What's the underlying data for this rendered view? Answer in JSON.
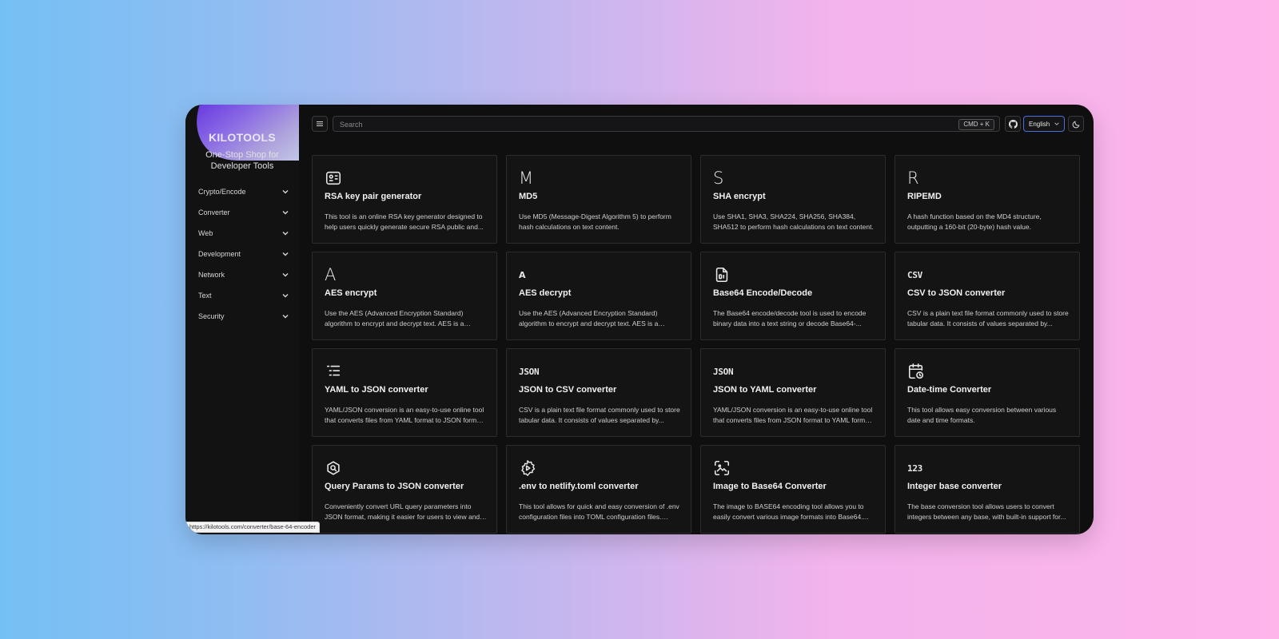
{
  "brand": {
    "title": "KILOTOOLS",
    "subtitle": "One-Stop Shop for Developer Tools"
  },
  "sidebar": {
    "items": [
      {
        "label": "Crypto/Encode"
      },
      {
        "label": "Converter"
      },
      {
        "label": "Web"
      },
      {
        "label": "Development"
      },
      {
        "label": "Network"
      },
      {
        "label": "Text"
      },
      {
        "label": "Security"
      }
    ]
  },
  "topbar": {
    "search_placeholder": "Search",
    "shortcut": "CMD + K",
    "language": "English"
  },
  "cards": [
    {
      "icon": "id-card-icon",
      "title": "RSA key pair generator",
      "desc": "This tool is an online RSA key generator designed to help users quickly generate secure RSA public and..."
    },
    {
      "icon_text": "M",
      "title": "MD5",
      "desc": "Use MD5 (Message-Digest Algorithm 5) to perform hash calculations on text content."
    },
    {
      "icon_text": "S",
      "title": "SHA encrypt",
      "desc": "Use SHA1, SHA3, SHA224, SHA256, SHA384, SHA512 to perform hash calculations on text content."
    },
    {
      "icon_text": "R",
      "title": "RIPEMD",
      "desc": "A hash function based on the MD4 structure, outputting a 160-bit (20-byte) hash value."
    },
    {
      "icon_text": "A",
      "title": "AES encrypt",
      "desc": "Use the AES (Advanced Encryption Standard) algorithm to encrypt and decrypt text. AES is a symmetric..."
    },
    {
      "icon_text": "A",
      "title": "AES decrypt",
      "desc": "Use the AES (Advanced Encryption Standard) algorithm to encrypt and decrypt text. AES is a symmetric..."
    },
    {
      "icon": "binary-file-icon",
      "title": "Base64 Encode/Decode",
      "desc": "The Base64 encode/decode tool is used to encode binary data into a text string or decode Base64-..."
    },
    {
      "icon_text": "CSV",
      "title": "CSV to JSON converter",
      "desc": "CSV is a plain text file format commonly used to store tabular data. It consists of values separated by..."
    },
    {
      "icon": "list-tree-icon",
      "title": "YAML to JSON converter",
      "desc": "YAML/JSON conversion is an easy-to-use online tool that converts files from YAML format to JSON format. ..."
    },
    {
      "icon_text": "JSON",
      "title": "JSON to CSV converter",
      "desc": "CSV is a plain text file format commonly used to store tabular data. It consists of values separated by..."
    },
    {
      "icon_text": "JSON",
      "title": "JSON to YAML converter",
      "desc": "YAML/JSON conversion is an easy-to-use online tool that converts files from JSON format to YAML format. ..."
    },
    {
      "icon": "calendar-clock-icon",
      "title": "Date-time Converter",
      "desc": "This tool allows easy conversion between various date and time formats."
    },
    {
      "icon": "search-badge-icon",
      "title": "Query Params to JSON converter",
      "desc": "Conveniently convert URL query parameters into JSON format, making it easier for users to view and use."
    },
    {
      "icon": "gear-play-icon",
      "title": ".env to netlify.toml converter",
      "desc": "This tool allows for quick and easy conversion of .env configuration files into TOML configuration files. TOM..."
    },
    {
      "icon": "image-scan-icon",
      "title": "Image to Base64 Converter",
      "desc": "The image to BASE64 encoding tool allows you to easily convert various image formats into Base64...."
    },
    {
      "icon_text": "123",
      "title": "Integer base converter",
      "desc": "The base conversion tool allows users to convert integers between any base, with built-in support for..."
    }
  ],
  "statusbar": {
    "url": "https://kilotools.com/converter/base-64-encoder"
  },
  "colors": {
    "app_bg": "#0f0f10",
    "card_bg": "#141415",
    "accent": "#6a38e8",
    "lang_border": "#4c6fe0"
  }
}
